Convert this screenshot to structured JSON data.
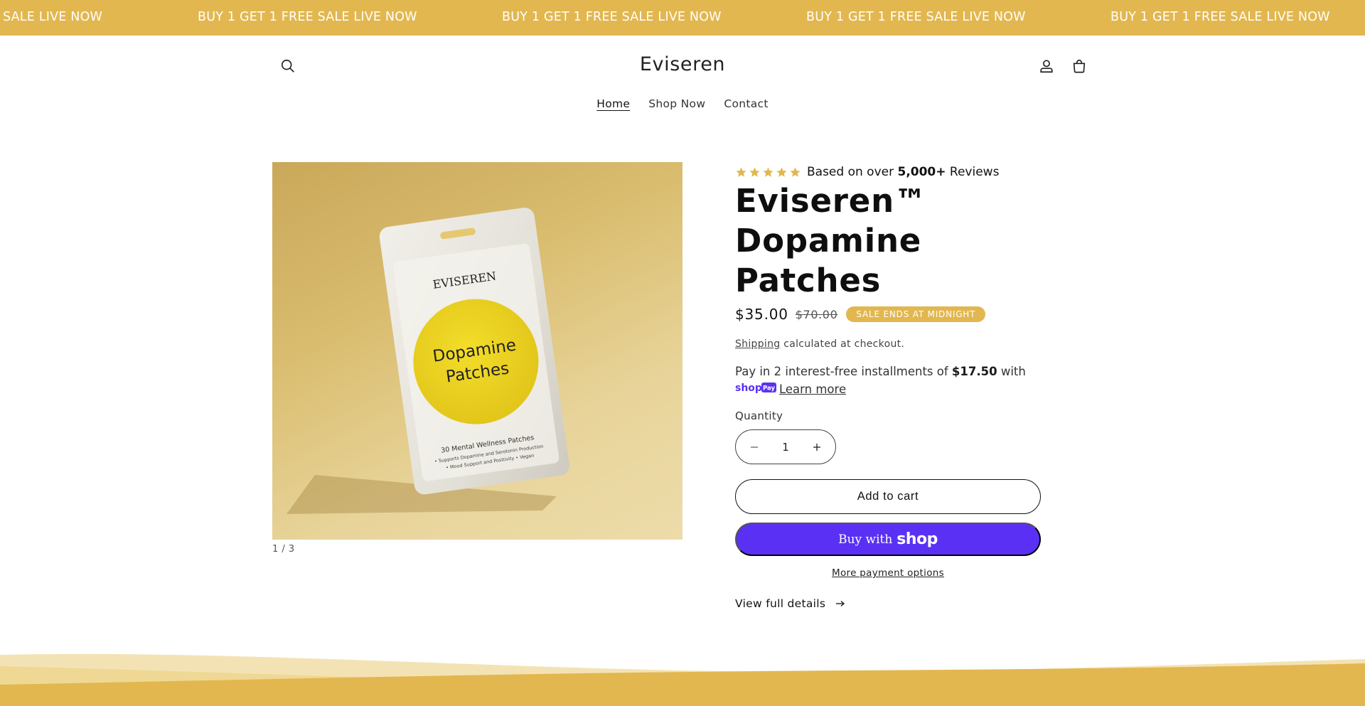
{
  "announcement": {
    "items": [
      "SALE LIVE NOW",
      "BUY 1 GET 1 FREE SALE LIVE NOW",
      "BUY 1 GET 1 FREE SALE LIVE NOW",
      "BUY 1 GET 1 FREE SALE LIVE NOW",
      "BUY 1 GET 1 FREE SALE LIVE NOW"
    ],
    "background_color": "#e2b74f"
  },
  "header": {
    "brand": "Eviseren",
    "icons": [
      "search-icon",
      "account-icon",
      "cart-icon"
    ],
    "nav": [
      {
        "label": "Home",
        "active": true
      },
      {
        "label": "Shop Now",
        "active": false
      },
      {
        "label": "Contact",
        "active": false
      }
    ]
  },
  "product": {
    "image": {
      "brand_text": "EVISEREN",
      "product_text_line1": "Dopamine",
      "product_text_line2": "Patches",
      "sub_line1": "30 Mental Wellness Patches",
      "sub_line2": "• Supports Dopamine and Serotonin Production",
      "sub_line3": "• Mood Support and Positivity • Vegan"
    },
    "media_counter": "1 / 3",
    "rating": {
      "stars": 5,
      "prefix": "Based on over ",
      "count": "5,000+",
      "suffix": " Reviews"
    },
    "title_line1": "Eviseren™",
    "title_line2": "Dopamine",
    "title_line3": "Patches",
    "price": "$35.00",
    "compare_price": "$70.00",
    "badge": "SALE ENDS AT MIDNIGHT",
    "shipping_link": "Shipping",
    "shipping_text": " calculated at checkout.",
    "installments": {
      "prefix": "Pay in 2 interest-free installments of ",
      "amount": "$17.50",
      "suffix": " with",
      "shop_pay_logo": "shop Pay",
      "learn_more": "Learn more"
    },
    "quantity_label": "Quantity",
    "quantity_value": "1",
    "add_to_cart": "Add to cart",
    "buy_with": "Buy with",
    "buy_shop_word": "shop",
    "more_payment": "More payment options",
    "view_full": "View full details"
  },
  "colors": {
    "accent": "#e2b74f",
    "shop_pay": "#5a31f4",
    "text": "#121212"
  }
}
